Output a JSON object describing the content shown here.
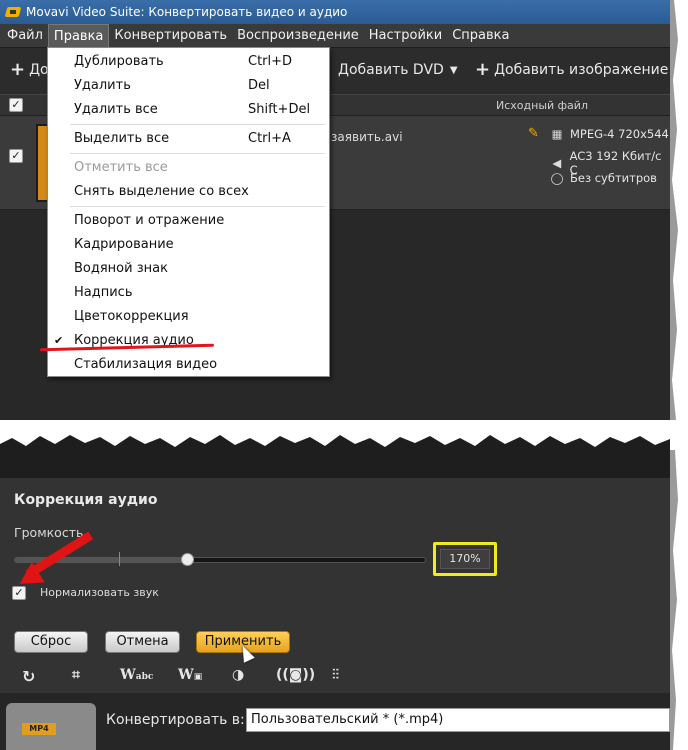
{
  "window": {
    "title": "Movavi Video Suite: Конвертировать видео и аудио"
  },
  "menubar": {
    "items": [
      "Файл",
      "Правка",
      "Конвертировать",
      "Воспроизведение",
      "Настройки",
      "Справка"
    ]
  },
  "toolbar": {
    "add_video_label": "До",
    "add_dvd_label": "Добавить DVD",
    "add_image_label": "Добавить изображение"
  },
  "file_list": {
    "header_source": "Исходный файл",
    "file_name": "ен заявить.avi",
    "video_info": "MPEG-4 720x544",
    "audio_info": "AC3 192 Кбит/с С",
    "subtitle_info": "Без субтитров"
  },
  "edit_menu": {
    "items": [
      {
        "label": "Дублировать",
        "shortcut": "Ctrl+D"
      },
      {
        "label": "Удалить",
        "shortcut": "Del"
      },
      {
        "label": "Удалить все",
        "shortcut": "Shift+Del"
      },
      {
        "label": "Выделить все",
        "shortcut": "Ctrl+A"
      },
      {
        "label": "Отметить все",
        "shortcut": ""
      },
      {
        "label": "Снять выделение со всех",
        "shortcut": ""
      },
      {
        "label": "Поворот и отражение",
        "shortcut": ""
      },
      {
        "label": "Кадрирование",
        "shortcut": ""
      },
      {
        "label": "Водяной знак",
        "shortcut": ""
      },
      {
        "label": "Надпись",
        "shortcut": ""
      },
      {
        "label": "Цветокоррекция",
        "shortcut": ""
      },
      {
        "label": "Коррекция аудио",
        "shortcut": ""
      },
      {
        "label": "Стабилизация видео",
        "shortcut": ""
      }
    ]
  },
  "audio_panel": {
    "title": "Коррекция аудио",
    "volume_label": "Громкость",
    "volume_value": "170%",
    "volume_fraction": 0.42,
    "normalize_label": "Нормализовать звук",
    "normalize_checked": true,
    "reset_label": "Сброс",
    "cancel_label": "Отмена",
    "apply_label": "Применить"
  },
  "effect_icons": [
    "rotate-icon",
    "crop-icon",
    "watermark-icon",
    "text-overlay-icon",
    "color-correction-icon",
    "stabilization-icon",
    "equalizer-icon"
  ],
  "convert_bar": {
    "label": "Конвертировать в:",
    "format_value": "Пользовательский * (*.mp4)",
    "format_tag": "MP4"
  },
  "colors": {
    "highlight_box": "#f2ea1a",
    "annotation_red": "#e01414",
    "apply_button": "#e7a21c"
  }
}
